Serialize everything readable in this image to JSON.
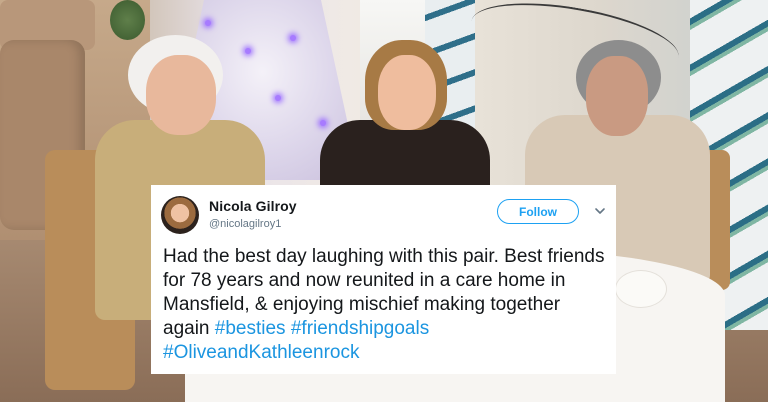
{
  "tweet": {
    "author_name": "Nicola Gilroy",
    "author_handle": "@nicolagilroy1",
    "follow_label": "Follow",
    "text_segments": [
      "Had the best day laughing with this pair. Best friends for 78 years and now reunited in a care home in Mansfield, & enjoying mischief making together again "
    ],
    "hashtags": [
      "#besties",
      "#friendshipgoals",
      "#OliveandKathleenrock"
    ]
  },
  "icons": {
    "avatar": "avatar",
    "menu": "chevron-down-icon"
  },
  "colors": {
    "accent": "#1da1f2",
    "hashtag": "#1b95e0",
    "text": "#14171a",
    "muted": "#657786"
  }
}
